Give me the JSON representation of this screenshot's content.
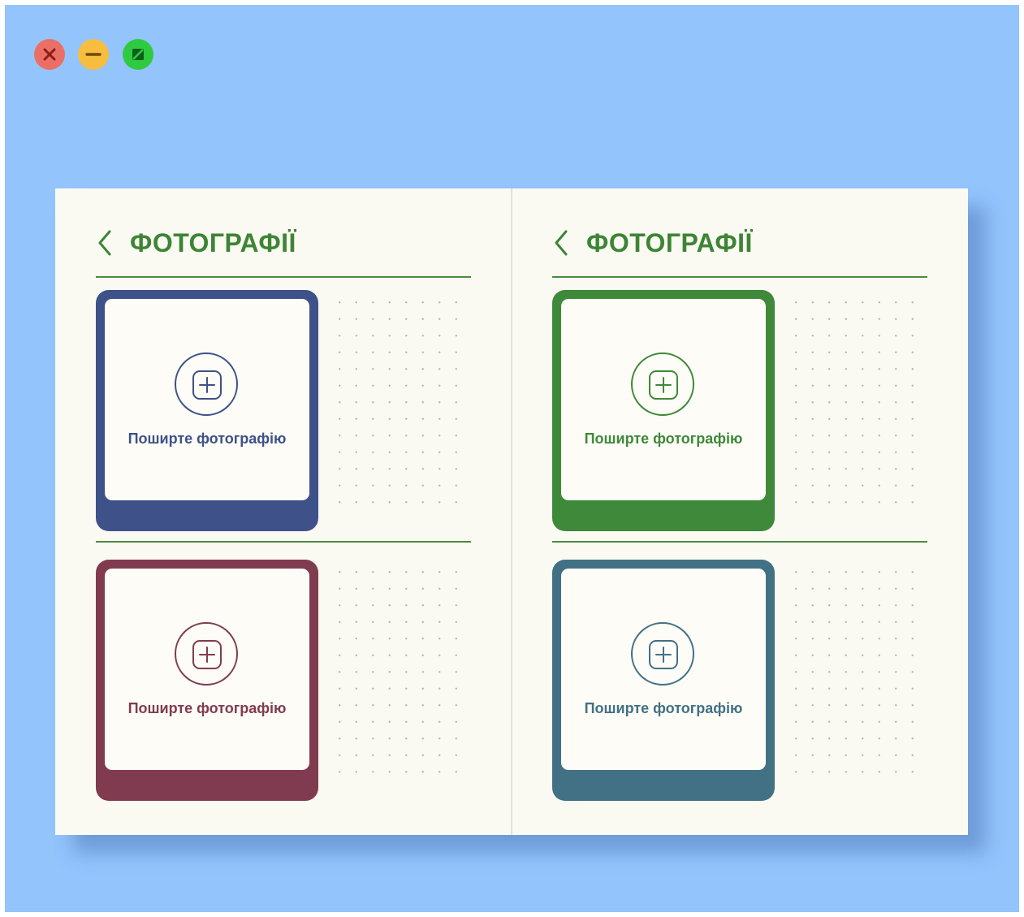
{
  "window": {
    "background_color": "#94c4fc",
    "controls": [
      {
        "name": "close",
        "color": "#ec6f66",
        "icon": "close-icon"
      },
      {
        "name": "minimize",
        "color": "#f6bd3f",
        "icon": "minimize-icon"
      },
      {
        "name": "maximize",
        "color": "#2ecb41",
        "icon": "maximize-icon"
      }
    ]
  },
  "book": {
    "page_color": "#fafaf3",
    "accent_color": "#3d8534",
    "pages": [
      {
        "back_icon": "chevron-left-icon",
        "title": "ФОТОГРАФІЇ",
        "cards": [
          {
            "color": "#3e5189",
            "caption": "Поширте фотографію",
            "icon": "add-photo-icon"
          },
          {
            "color": "#813b50",
            "caption": "Поширте фотографію",
            "icon": "add-photo-icon"
          }
        ]
      },
      {
        "back_icon": "chevron-left-icon",
        "title": "ФОТОГРАФІЇ",
        "cards": [
          {
            "color": "#3e893a",
            "caption": "Поширте фотографію",
            "icon": "add-photo-icon"
          },
          {
            "color": "#427186",
            "caption": "Поширте фотографію",
            "icon": "add-photo-icon"
          }
        ]
      }
    ]
  }
}
